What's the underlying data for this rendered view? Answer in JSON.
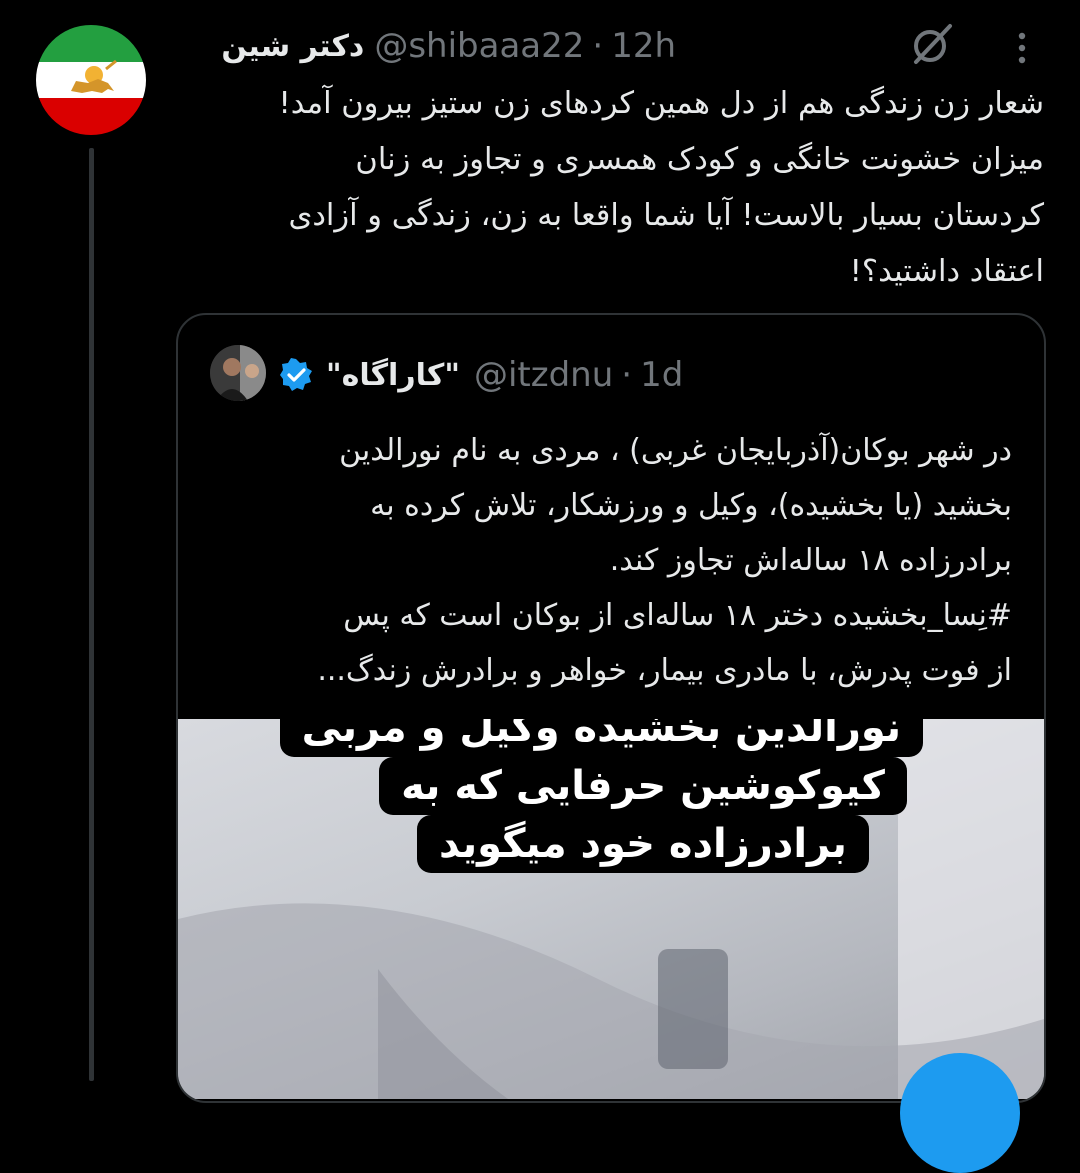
{
  "tweet": {
    "display_name": "دکتر شین",
    "handle": "@shibaaa22",
    "separator": "·",
    "time": "12h",
    "text_lines": [
      "شعار زن زندگی هم از دل همین کردهای زن ستیز بیرون آمد!",
      "میزان خشونت خانگی و کودک همسری و تجاوز به زنان",
      "کردستان بسیار بالاست! آیا شما واقعا به زن، زندگی و آزادی",
      "اعتقاد داشتید؟!"
    ],
    "avatar_icon": "iran-lion-and-sun-flag-icon",
    "grok_icon": "grok-icon",
    "more_icon": "more-vertical-icon"
  },
  "quoted": {
    "display_name": "\"کاراگاه\"",
    "handle": "@itzdnu",
    "separator": "·",
    "time": "1d",
    "verified_icon": "verified-badge-icon",
    "text_lines": [
      "در شهر بوکان(آذربایجان غربی) ، مردی به نام نورالدین",
      "بخشید (یا بخشیده)، وکیل و ورزشکار، تلاش کرده به",
      "برادرزاده ۱۸ ساله‌اش تجاوز کند.",
      "#نِسا_بخشیده دختر ۱۸ ساله‌ای از بوکان است که پس",
      "از فوت پدرش، با مادری بیمار، خواهر و برادرش زندگ..."
    ],
    "media_caption_lines": [
      "نورالدین بخشیده وکیل و مربی",
      "کیوکوشین حرفایی که به",
      "برادرزاده خود میگوید"
    ]
  },
  "colors": {
    "background": "#000000",
    "text": "#e7e9ea",
    "muted": "#71767b",
    "border": "#2f3336",
    "accent": "#1d9bf0"
  }
}
